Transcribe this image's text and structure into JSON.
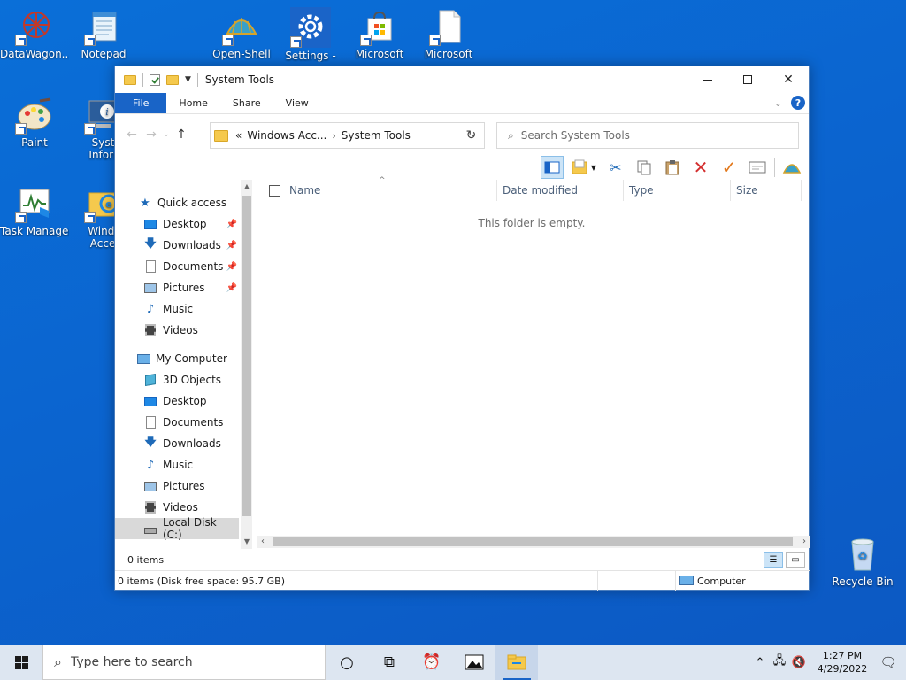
{
  "desktop": {
    "icons": [
      {
        "label": "DataWagon..."
      },
      {
        "label": "Notepad"
      },
      {
        "label": "Open-Shell"
      },
      {
        "label": "Settings -"
      },
      {
        "label": "Microsoft"
      },
      {
        "label": "Microsoft"
      },
      {
        "label": "Paint"
      },
      {
        "label": "System Informat"
      },
      {
        "label": "Task Manager"
      },
      {
        "label": "Windows Accesso"
      },
      {
        "label": "Recycle Bin"
      }
    ]
  },
  "window": {
    "title": "System Tools",
    "ribbon_tabs": [
      "File",
      "Home",
      "Share",
      "View"
    ],
    "address": {
      "overflow": "«",
      "crumbs": [
        "Windows Acc...",
        "System Tools"
      ]
    },
    "search": {
      "placeholder": "Search System Tools"
    },
    "nav": {
      "quick_access": "Quick access",
      "quick_items": [
        "Desktop",
        "Downloads",
        "Documents",
        "Pictures",
        "Music",
        "Videos"
      ],
      "computer": "My Computer",
      "computer_items": [
        "3D Objects",
        "Desktop",
        "Documents",
        "Downloads",
        "Music",
        "Pictures",
        "Videos",
        "Local Disk (C:)"
      ]
    },
    "columns": [
      "Name",
      "Date modified",
      "Type",
      "Size"
    ],
    "empty_message": "This folder is empty.",
    "status": {
      "items": "0 items",
      "details": "0 items (Disk free space: 95.7 GB)",
      "location": "Computer"
    }
  },
  "taskbar": {
    "search_placeholder": "Type here to search",
    "time": "1:27 PM",
    "date": "4/29/2022"
  }
}
